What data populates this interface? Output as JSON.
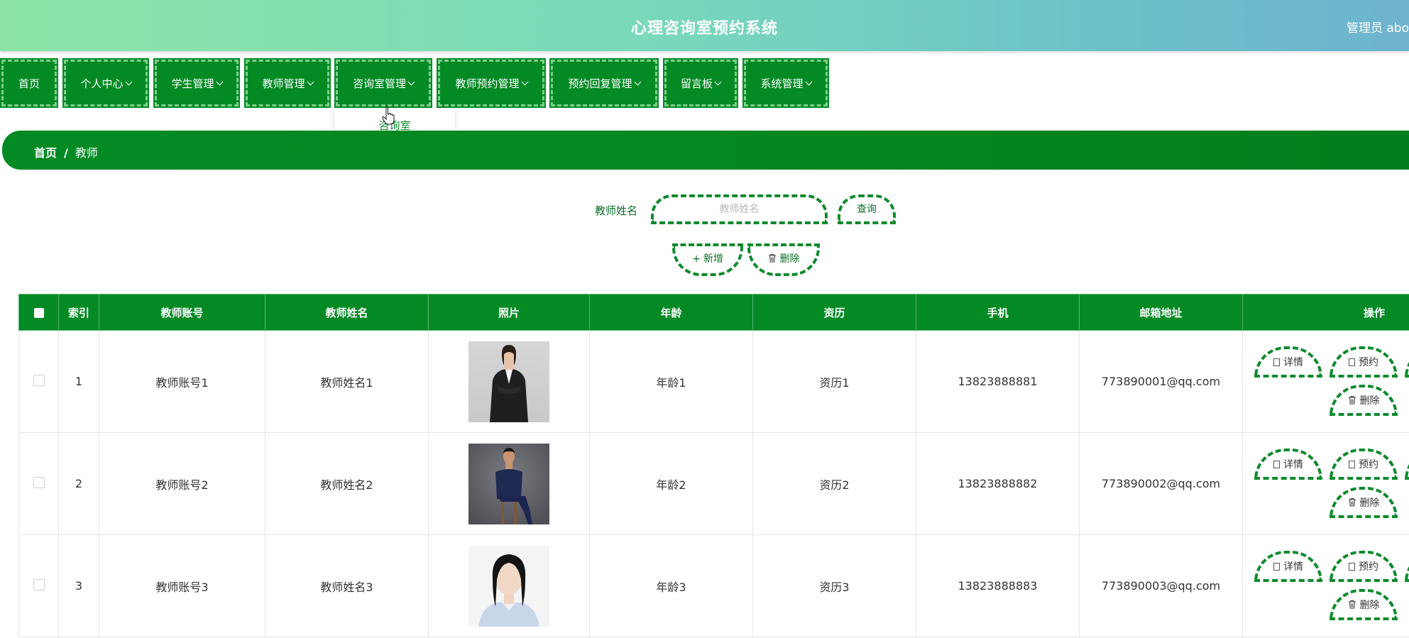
{
  "header": {
    "title": "心理咨询室预约系统",
    "admin": "管理员 abo"
  },
  "nav": {
    "items": [
      {
        "label": "首页",
        "dropdown": false
      },
      {
        "label": "个人中心",
        "dropdown": true
      },
      {
        "label": "学生管理",
        "dropdown": true
      },
      {
        "label": "教师管理",
        "dropdown": true
      },
      {
        "label": "咨询室管理",
        "dropdown": true
      },
      {
        "label": "教师预约管理",
        "dropdown": true
      },
      {
        "label": "预约回复管理",
        "dropdown": true
      },
      {
        "label": "留言板",
        "dropdown": true
      },
      {
        "label": "系统管理",
        "dropdown": true
      }
    ],
    "open_dropdown": {
      "parent": "咨询室管理",
      "items": [
        "咨询室"
      ]
    }
  },
  "breadcrumb": {
    "home": "首页",
    "separator": "/",
    "current": "教师"
  },
  "search": {
    "label": "教师姓名",
    "placeholder": "教师姓名",
    "query_label": "查询",
    "add_label": "新增",
    "delete_label": "删除"
  },
  "table": {
    "columns": [
      "索引",
      "教师账号",
      "教师姓名",
      "照片",
      "年龄",
      "资历",
      "手机",
      "邮箱地址",
      "操作"
    ],
    "rows": [
      {
        "index": "1",
        "account": "教师账号1",
        "name": "教师姓名1",
        "age": "年龄1",
        "qualification": "资历1",
        "phone": "13823888881",
        "email": "773890001@qq.com"
      },
      {
        "index": "2",
        "account": "教师账号2",
        "name": "教师姓名2",
        "age": "年龄2",
        "qualification": "资历2",
        "phone": "13823888882",
        "email": "773890002@qq.com"
      },
      {
        "index": "3",
        "account": "教师账号3",
        "name": "教师姓名3",
        "age": "年龄3",
        "qualification": "资历3",
        "phone": "13823888883",
        "email": "773890003@qq.com"
      }
    ],
    "actions": {
      "detail": "详情",
      "book": "预约",
      "delete": "删除"
    }
  },
  "colors": {
    "primary_green": "#038a25",
    "dashed_green": "#0e8a2d",
    "header_gradient_start": "#8be4a6",
    "header_gradient_end": "#6fb3cf"
  }
}
